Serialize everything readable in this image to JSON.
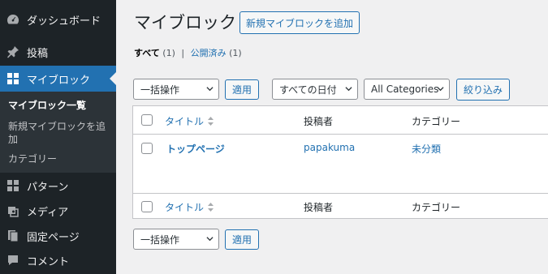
{
  "sidebar": {
    "items": [
      {
        "label": "ダッシュボード",
        "icon": "dashboard-icon"
      },
      {
        "label": "投稿",
        "icon": "pin-icon"
      },
      {
        "label": "マイブロック",
        "icon": "blocks-icon"
      },
      {
        "label": "パターン",
        "icon": "patterns-icon"
      },
      {
        "label": "メディア",
        "icon": "media-icon"
      },
      {
        "label": "固定ページ",
        "icon": "pages-icon"
      },
      {
        "label": "コメント",
        "icon": "comment-icon"
      }
    ],
    "submenu": {
      "current": "マイブロック一覧",
      "add_line1": "新規マイブロックを追",
      "add_line2": "加",
      "categories": "カテゴリー"
    }
  },
  "main": {
    "title": "マイブロック",
    "add_button": "新規マイブロックを追加",
    "filters": {
      "all": "すべて",
      "all_count": "(1)",
      "separator": "|",
      "published": "公開済み",
      "published_count": "(1)"
    },
    "bulk_action": "一括操作",
    "apply": "適用",
    "date_filter": "すべての日付",
    "category_filter": "All Categories",
    "filter_button": "絞り込み"
  },
  "table": {
    "columns": [
      "タイトル",
      "投稿者",
      "カテゴリー"
    ],
    "rows": [
      {
        "title": "トップページ",
        "author": "papakuma",
        "category": "未分類"
      }
    ]
  },
  "colors": {
    "sidebar_bg": "#1d2327",
    "accent": "#2271b1",
    "page_bg": "#f0f0f1"
  }
}
